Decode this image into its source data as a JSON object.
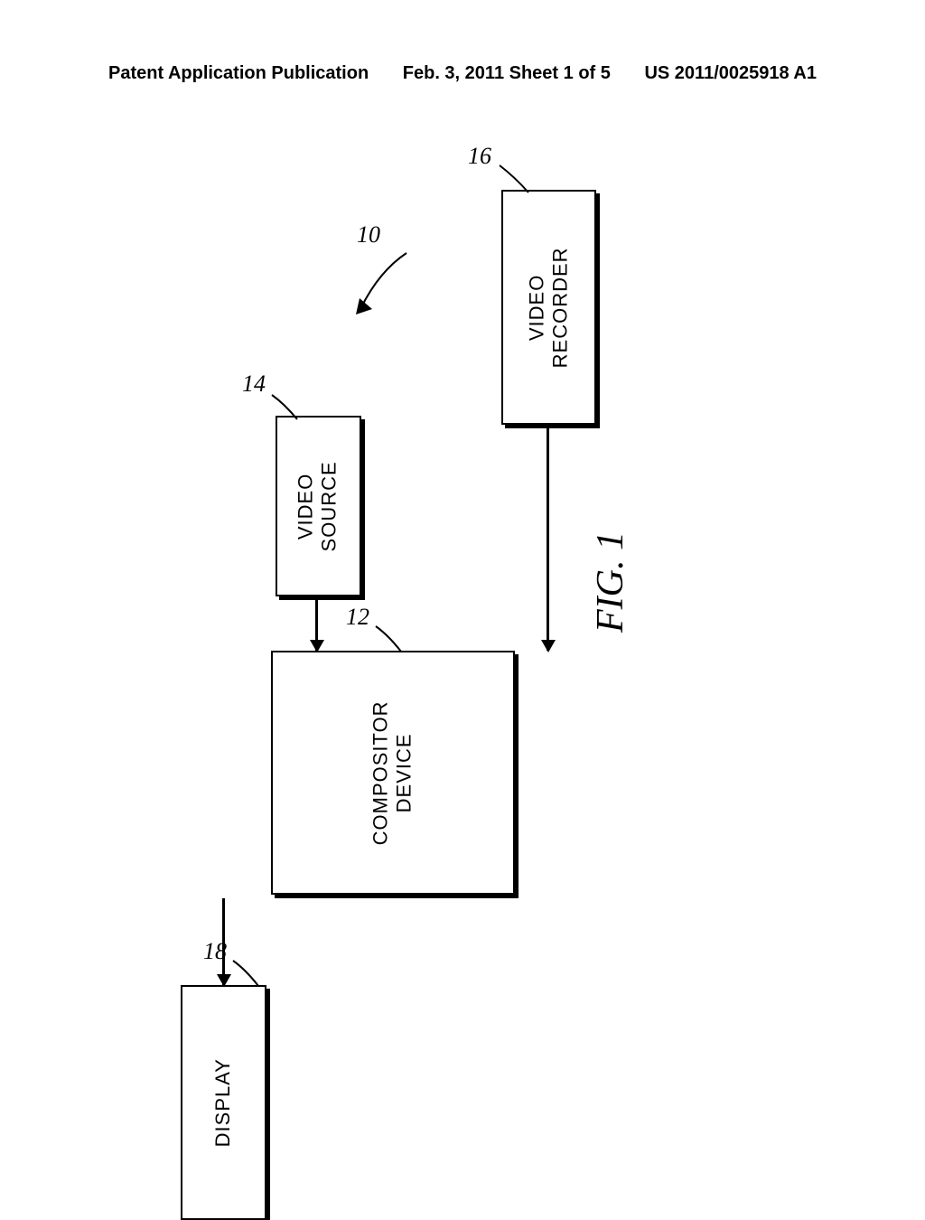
{
  "header": {
    "left": "Patent Application Publication",
    "center": "Feb. 3, 2011  Sheet 1 of 5",
    "right": "US 2011/0025918 A1"
  },
  "refs": {
    "system": "10",
    "compositor": "12",
    "source": "14",
    "recorder": "16",
    "display": "18"
  },
  "boxes": {
    "video_source": "VIDEO\nSOURCE",
    "video_recorder": "VIDEO\nRECORDER",
    "compositor": "COMPOSITOR\nDEVICE",
    "display": "DISPLAY"
  },
  "figure_label": "FIG. 1"
}
